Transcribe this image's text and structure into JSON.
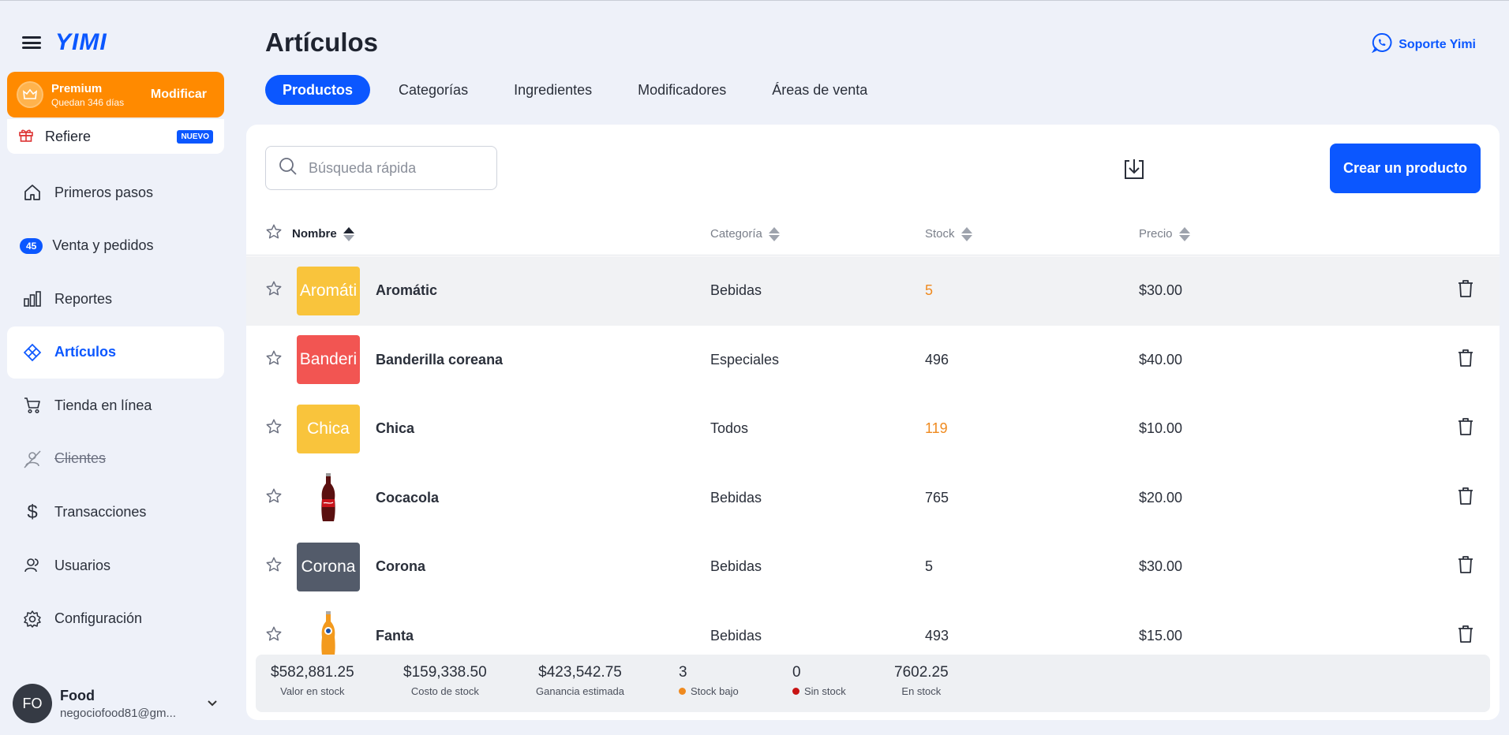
{
  "brand": {
    "logo": "YIMI"
  },
  "premium": {
    "title": "Premium",
    "subtitle": "Quedan 346 días",
    "action": "Modificar"
  },
  "refer": {
    "label": "Refiere",
    "badge": "NUEVO"
  },
  "nav": {
    "primeros": "Primeros pasos",
    "ventas_badge": "45",
    "ventas": "Venta y pedidos",
    "reportes": "Reportes",
    "articulos": "Artículos",
    "tienda": "Tienda en línea",
    "clientes": "Clientes",
    "transacciones": "Transacciones",
    "usuarios": "Usuarios",
    "configuracion": "Configuración"
  },
  "user": {
    "initials": "FO",
    "name": "Food",
    "email": "negociofood81@gm..."
  },
  "page": {
    "title": "Artículos",
    "support": "Soporte Yimi"
  },
  "tabs": [
    "Productos",
    "Categorías",
    "Ingredientes",
    "Modificadores",
    "Áreas de venta"
  ],
  "toolbar": {
    "search_placeholder": "Búsqueda rápida",
    "create_label": "Crear un producto"
  },
  "columns": {
    "name": "Nombre",
    "category": "Categoría",
    "stock": "Stock",
    "price": "Precio"
  },
  "products": [
    {
      "thumb": "Aromáti",
      "thumb_color": "#f9c43c",
      "name": "Aromátic",
      "category": "Bebidas",
      "stock": "5",
      "stock_low": true,
      "price": "$30.00"
    },
    {
      "thumb": "Banderi",
      "thumb_color": "#f25552",
      "name": "Banderilla coreana",
      "category": "Especiales",
      "stock": "496",
      "stock_low": false,
      "price": "$40.00"
    },
    {
      "thumb": "Chica",
      "thumb_color": "#f9c43c",
      "name": "Chica",
      "category": "Todos",
      "stock": "119",
      "stock_low": true,
      "price": "$10.00"
    },
    {
      "thumb": "",
      "thumb_color": "",
      "name": "Cocacola",
      "category": "Bebidas",
      "stock": "765",
      "stock_low": false,
      "price": "$20.00"
    },
    {
      "thumb": "Corona",
      "thumb_color": "#535b6a",
      "name": "Corona",
      "category": "Bebidas",
      "stock": "5",
      "stock_low": false,
      "price": "$30.00"
    },
    {
      "thumb": "",
      "thumb_color": "",
      "name": "Fanta",
      "category": "Bebidas",
      "stock": "493",
      "stock_low": false,
      "price": "$15.00"
    }
  ],
  "summary": {
    "valor": {
      "value": "$582,881.25",
      "label": "Valor en stock"
    },
    "costo": {
      "value": "$159,338.50",
      "label": "Costo de stock"
    },
    "ganancia": {
      "value": "$423,542.75",
      "label": "Ganancia estimada"
    },
    "bajo": {
      "value": "3",
      "label": "Stock bajo",
      "color": "#ef8a1f"
    },
    "sin": {
      "value": "0",
      "label": "Sin stock",
      "color": "#c81414"
    },
    "en": {
      "value": "7602.25",
      "label": "En stock"
    }
  },
  "colors": {
    "accent": "#0b57ff",
    "premium": "#ff8a00",
    "low_stock": "#ef8a1f"
  }
}
